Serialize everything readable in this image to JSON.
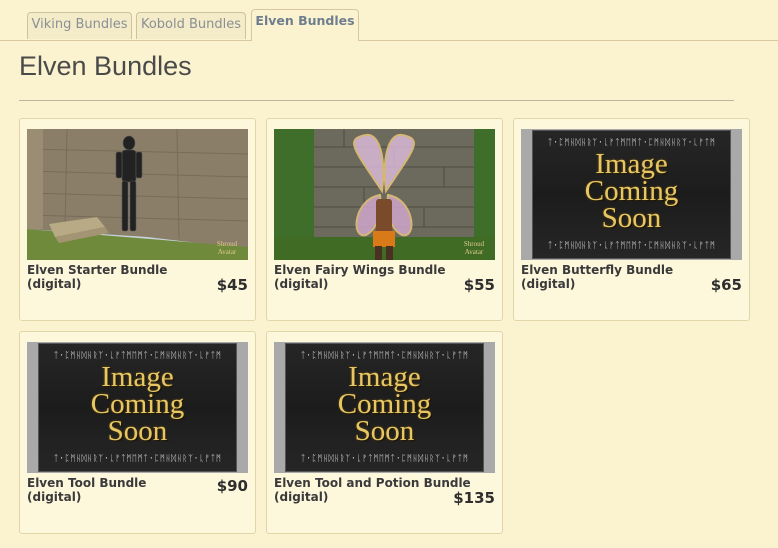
{
  "tabs": [
    {
      "label": "Viking Bundles",
      "active": false
    },
    {
      "label": "Kobold Bundles",
      "active": false
    },
    {
      "label": "Elven Bundles",
      "active": true
    }
  ],
  "page_title": "Elven Bundles",
  "placeholder": {
    "text_lines": [
      "Image",
      "Coming",
      "Soon"
    ],
    "rune_border": "ᛏ·ᛈᛗᚺᛞᚺᚱᛉ·ᚳᚠᛏᛗᛖᛗᛏ·ᛈᛗᚺᛞᚺᚱᛉ·ᚳᚠᛏᛗ"
  },
  "products": [
    {
      "name": "Elven Starter Bundle (digital)",
      "price": "$45",
      "image": "elven-armor-figure"
    },
    {
      "name": "Elven Fairy Wings Bundle (digital)",
      "price": "$55",
      "image": "fairy-wings-figure"
    },
    {
      "name": "Elven Butterfly Bundle (digital)",
      "price": "$65",
      "image": "image-coming-soon"
    },
    {
      "name": "Elven Tool Bundle (digital)",
      "price": "$90",
      "image": "image-coming-soon"
    },
    {
      "name": "Elven Tool and Potion Bundle (digital)",
      "price": "$135",
      "image": "image-coming-soon"
    }
  ],
  "colors": {
    "page_bg": "#fbf3cf",
    "card_bg": "#fdf7dc",
    "placeholder_gold": "#e7c765"
  }
}
